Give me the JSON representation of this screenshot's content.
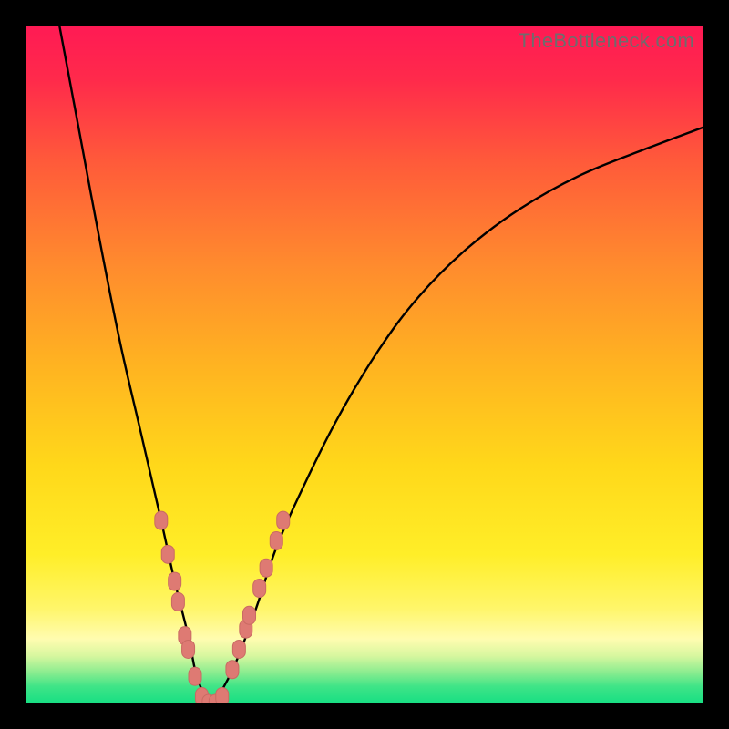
{
  "watermark": "TheBottleneck.com",
  "colors": {
    "frame": "#000000",
    "gradient_stops": [
      {
        "offset": 0.0,
        "color": "#ff1a54"
      },
      {
        "offset": 0.08,
        "color": "#ff2a4b"
      },
      {
        "offset": 0.2,
        "color": "#ff5a3a"
      },
      {
        "offset": 0.35,
        "color": "#ff8a2e"
      },
      {
        "offset": 0.5,
        "color": "#ffb321"
      },
      {
        "offset": 0.65,
        "color": "#ffd81a"
      },
      {
        "offset": 0.78,
        "color": "#ffee28"
      },
      {
        "offset": 0.86,
        "color": "#fff66a"
      },
      {
        "offset": 0.905,
        "color": "#fffcb0"
      },
      {
        "offset": 0.93,
        "color": "#d7f79f"
      },
      {
        "offset": 0.955,
        "color": "#88ec8f"
      },
      {
        "offset": 0.975,
        "color": "#3fe487"
      },
      {
        "offset": 1.0,
        "color": "#17df83"
      }
    ],
    "curve": "#000000",
    "marker_fill": "#de7a73",
    "marker_stroke": "#c96a63"
  },
  "chart_data": {
    "type": "line",
    "title": "",
    "xlabel": "",
    "ylabel": "",
    "xlim": [
      0,
      100
    ],
    "ylim": [
      0,
      100
    ],
    "grid": false,
    "series": [
      {
        "name": "bottleneck-curve",
        "note": "V-shaped mismatch curve; y ≈ 0 near x ≈ 27 (optimal), rises steeply on both sides. y read as percent of plot height from bottom.",
        "x": [
          5,
          8,
          11,
          14,
          17,
          20,
          22,
          24,
          25,
          26,
          27,
          28,
          29,
          31,
          34,
          37,
          41,
          46,
          52,
          58,
          65,
          73,
          82,
          92,
          100
        ],
        "y": [
          100,
          84,
          68,
          53,
          40,
          27,
          18,
          10,
          5,
          2,
          0,
          0,
          2,
          6,
          14,
          23,
          32,
          42,
          52,
          60,
          67,
          73,
          78,
          82,
          85
        ]
      }
    ],
    "markers": {
      "name": "highlighted-points",
      "note": "Pink lozenge markers clustered near the trough on both branches.",
      "points": [
        {
          "x": 20.0,
          "y": 27
        },
        {
          "x": 21.0,
          "y": 22
        },
        {
          "x": 22.0,
          "y": 18
        },
        {
          "x": 22.5,
          "y": 15
        },
        {
          "x": 23.5,
          "y": 10
        },
        {
          "x": 24.0,
          "y": 8
        },
        {
          "x": 25.0,
          "y": 4
        },
        {
          "x": 26.0,
          "y": 1
        },
        {
          "x": 27.0,
          "y": 0
        },
        {
          "x": 28.0,
          "y": 0
        },
        {
          "x": 29.0,
          "y": 1
        },
        {
          "x": 30.5,
          "y": 5
        },
        {
          "x": 31.5,
          "y": 8
        },
        {
          "x": 32.5,
          "y": 11
        },
        {
          "x": 33.0,
          "y": 13
        },
        {
          "x": 34.5,
          "y": 17
        },
        {
          "x": 35.5,
          "y": 20
        },
        {
          "x": 37.0,
          "y": 24
        },
        {
          "x": 38.0,
          "y": 27
        }
      ]
    }
  }
}
